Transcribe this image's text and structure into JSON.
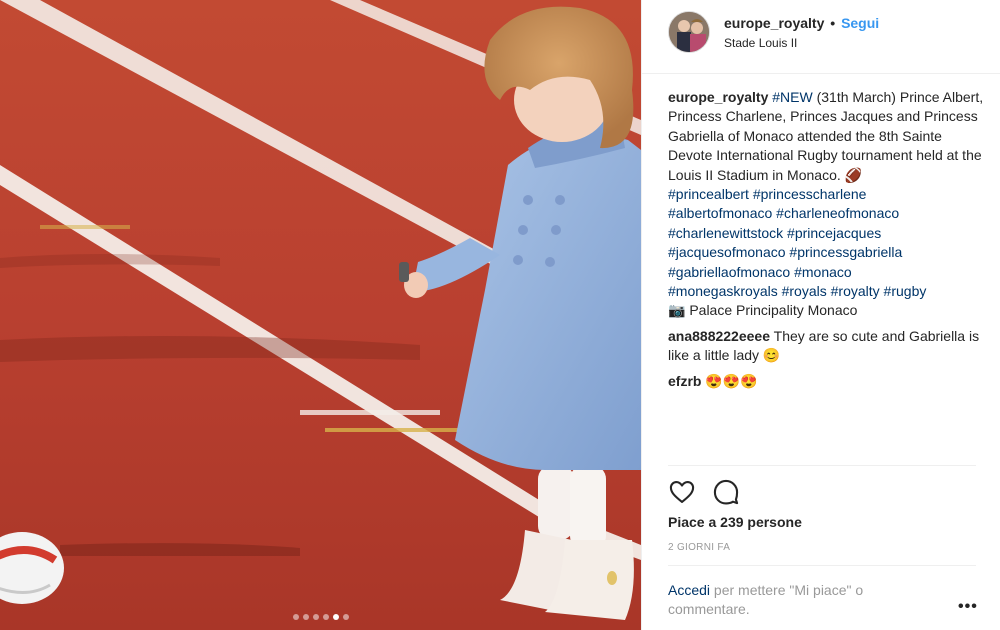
{
  "post": {
    "username": "europe_royalty",
    "separator": "•",
    "follow_label": "Segui",
    "location": "Stade Louis II",
    "caption": {
      "author": "europe_royalty",
      "hashtag_new": "#NEW",
      "text": " (31th March) Prince Albert, Princess Charlene, Princes Jacques and Princess Gabriella of Monaco attended the 8th Sainte Devote International Rugby tournament held at the Louis II Stadium in Monaco. 🏈",
      "hashtag_lines": [
        "#princealbert #princesscharlene",
        "#albertofmonaco #charleneofmonaco",
        "#charlenewittstock #princejacques",
        "#jacquesofmonaco #princessgabriella",
        "#gabriellaofmonaco #monaco",
        "#monegaskroyals #royals #royalty #rugby"
      ],
      "credit": "📷 Palace Principality Monaco"
    },
    "comments": [
      {
        "author": "ana888222eeee",
        "text": "They are so cute and Gabriella is like a little lady 😊"
      },
      {
        "author": "efzrb",
        "text": "😍😍😍"
      }
    ],
    "likes": "Piace a 239 persone",
    "time": "2 GIORNI FA",
    "login_link": "Accedi",
    "login_text": " per mettere \"Mi piace\" o commentare.",
    "more_label": "•••",
    "carousel": {
      "count": 6,
      "active_index": 4
    },
    "icons": {
      "like": "heart-icon",
      "comment": "comment-icon",
      "more": "more-options-icon"
    },
    "colors": {
      "accent": "#3897f0",
      "link": "#003569",
      "muted": "#999999",
      "track": "#b94030"
    }
  }
}
